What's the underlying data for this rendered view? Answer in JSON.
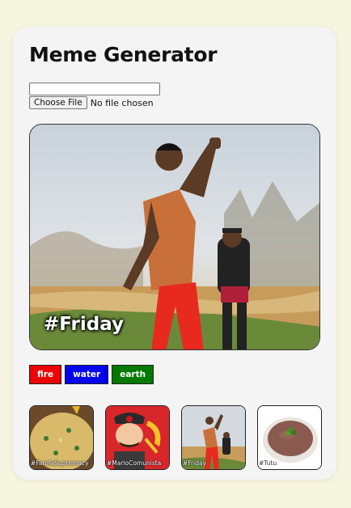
{
  "app": {
    "title": "Meme Generator"
  },
  "upload": {
    "text_value": "",
    "file_button_label": "Choose File",
    "file_status": "No file chosen"
  },
  "preview": {
    "caption": "#Friday"
  },
  "themes": [
    {
      "label": "fire",
      "color": "#ee0000"
    },
    {
      "label": "water",
      "color": "#0000ee"
    },
    {
      "label": "earth",
      "color": "#007a00"
    }
  ],
  "gallery": [
    {
      "label": "#FarofaSupremacy"
    },
    {
      "label": "#MarioComunista"
    },
    {
      "label": "#Friday"
    },
    {
      "label": "#Tutu"
    }
  ]
}
